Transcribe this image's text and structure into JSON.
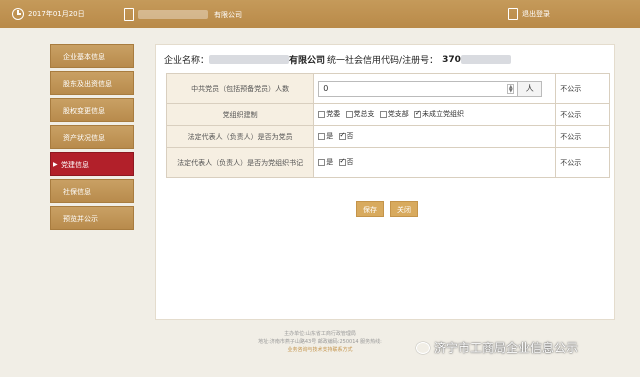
{
  "topbar": {
    "date": "2017年01月20日",
    "company_suffix": "有限公司",
    "logout": "退出登录"
  },
  "sidebar": {
    "items": [
      {
        "label": "企业基本信息",
        "active": false
      },
      {
        "label": "股东及出资信息",
        "active": false
      },
      {
        "label": "股权变更信息",
        "active": false
      },
      {
        "label": "资产状况信息",
        "active": false
      },
      {
        "label": "党建信息",
        "active": true
      },
      {
        "label": "社保信息",
        "active": false
      },
      {
        "label": "预览并公示",
        "active": false
      }
    ]
  },
  "main": {
    "company_label": "企业名称：",
    "company_suffix": "有限公司",
    "credit_label": "统一社会信用代码/注册号：",
    "credit_prefix": "370",
    "rows": [
      {
        "label": "中共党员（包括预备党员）人数",
        "value": "0",
        "unit": "人",
        "publicity": "不公示"
      },
      {
        "label": "党组织建制",
        "options": [
          "党委",
          "党总支",
          "党支部",
          "未成立党组织"
        ],
        "checked": [
          false,
          false,
          false,
          true
        ],
        "publicity": "不公示"
      },
      {
        "label": "法定代表人（负责人）是否为党员",
        "options": [
          "是",
          "否"
        ],
        "checked": [
          false,
          true
        ],
        "publicity": "不公示"
      },
      {
        "label": "法定代表人（负责人）是否为党组织书记",
        "options": [
          "是",
          "否"
        ],
        "checked": [
          false,
          true
        ],
        "publicity": "不公示"
      }
    ],
    "save_label": "保存",
    "close_label": "关闭"
  },
  "footer": {
    "line1": "主办单位:山东省工商行政管理局",
    "line2": "地址:济南市燕子山路43号    邮政编码:250014    服务热线:",
    "line3": "业务咨询与技术支持联系方式"
  },
  "watermark": "济宁市工商局企业信息公示"
}
